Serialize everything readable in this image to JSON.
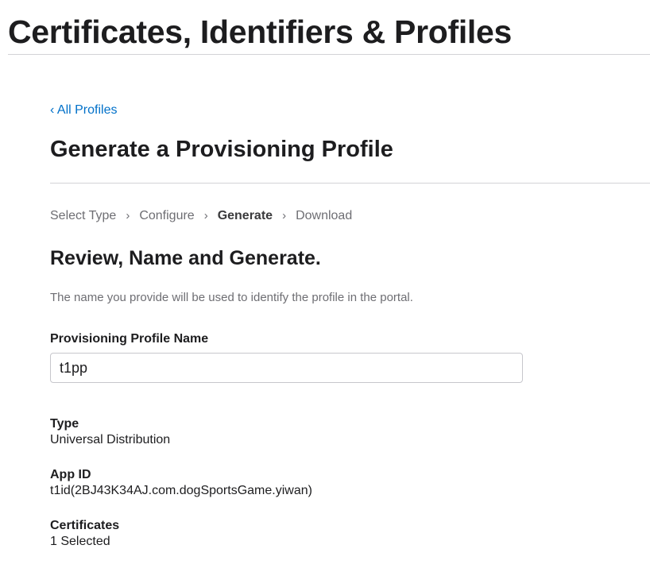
{
  "portal": {
    "title": "Certificates, Identifiers & Profiles"
  },
  "nav": {
    "back_label": "‹ All Profiles"
  },
  "page": {
    "heading": "Generate a Provisioning Profile"
  },
  "steps": [
    {
      "label": "Select Type",
      "active": false
    },
    {
      "label": "Configure",
      "active": false
    },
    {
      "label": "Generate",
      "active": true
    },
    {
      "label": "Download",
      "active": false
    }
  ],
  "step_separator": "›",
  "review": {
    "heading": "Review, Name and Generate.",
    "hint": "The name you provide will be used to identify the profile in the portal."
  },
  "form": {
    "name_label": "Provisioning Profile Name",
    "name_value": "t1pp"
  },
  "details": {
    "type_label": "Type",
    "type_value": "Universal Distribution",
    "app_id_label": "App ID",
    "app_id_value": "t1id(2BJ43K34AJ.com.dogSportsGame.yiwan)",
    "certificates_label": "Certificates",
    "certificates_value": "1 Selected"
  },
  "colors": {
    "link": "#0070c9",
    "text": "#1d1d1f",
    "muted": "#6e6e73",
    "rule": "#d2d2d7"
  }
}
